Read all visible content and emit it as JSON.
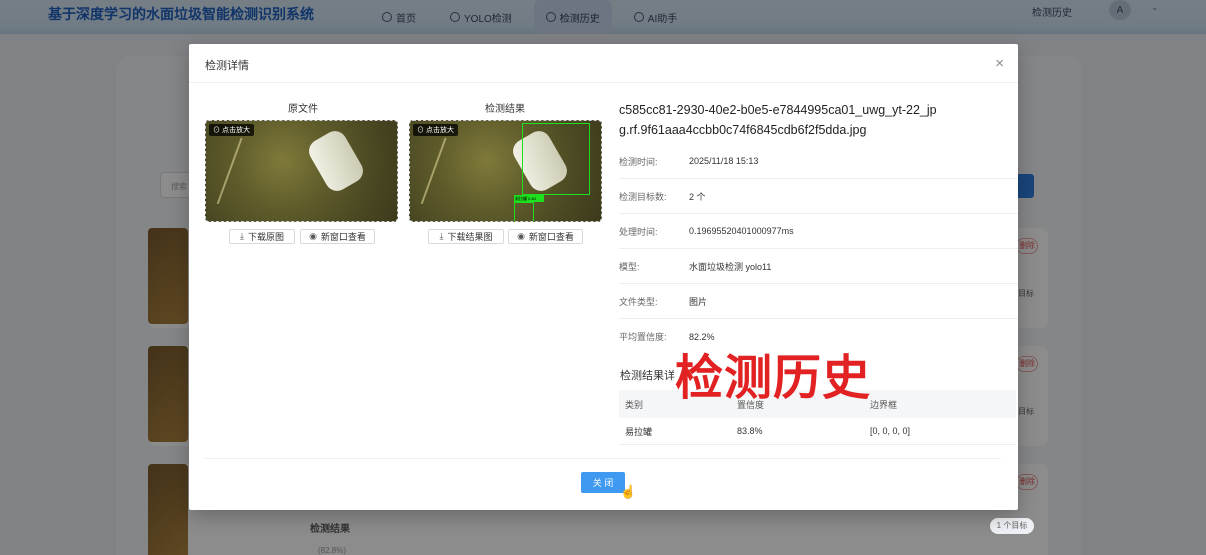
{
  "app": {
    "brand": "基于深度学习的水面垃圾智能检测识别系统",
    "nav": [
      {
        "label": "首页",
        "active": false
      },
      {
        "label": "YOLO检测",
        "active": false
      },
      {
        "label": "检测历史",
        "active": true
      },
      {
        "label": "AI助手",
        "active": false
      }
    ],
    "right_title": "检测历史",
    "avatar_glyph": "A",
    "chevron": "⌄"
  },
  "background": {
    "search_placeholder": "搜索",
    "delete_label": "删除",
    "target_label": "目标",
    "result_label": "检测结果",
    "target_count": "1 个目标",
    "percent": "(82.8%)"
  },
  "modal": {
    "title": "检测详情",
    "close_glyph": "×",
    "original_label": "原文件",
    "result_label": "检测结果",
    "zoom_badge": "⊙ 点击放大",
    "download_original": "下载原图",
    "download_result": "下载结果图",
    "open_new_window": "新窗口查看",
    "detection_tag": "易拉罐 0.84",
    "filename": "c585cc81-2930-40e2-b0e5-e7844995ca01_uwg_yt-22_jpg.rf.9f61aaa4ccbb0c74f6845cdb6f2f5dda.jpg",
    "info": [
      {
        "key": "检测时间:",
        "value": "2025/11/18 15:13"
      },
      {
        "key": "检测目标数:",
        "value": "2 个"
      },
      {
        "key": "处理时间:",
        "value": "0.19695520401000977ms"
      },
      {
        "key": "模型:",
        "value": "水面垃圾检测 yolo11"
      },
      {
        "key": "文件类型:",
        "value": "图片"
      },
      {
        "key": "平均置信度:",
        "value": "82.2%"
      }
    ],
    "results_title": "检测结果详",
    "table": {
      "headers": [
        "类别",
        "置信度",
        "边界框"
      ],
      "rows": [
        [
          "易拉罐",
          "83.8%",
          "[0, 0, 0, 0]"
        ]
      ]
    },
    "close_button": "关 闭"
  },
  "watermark": "检测历史"
}
